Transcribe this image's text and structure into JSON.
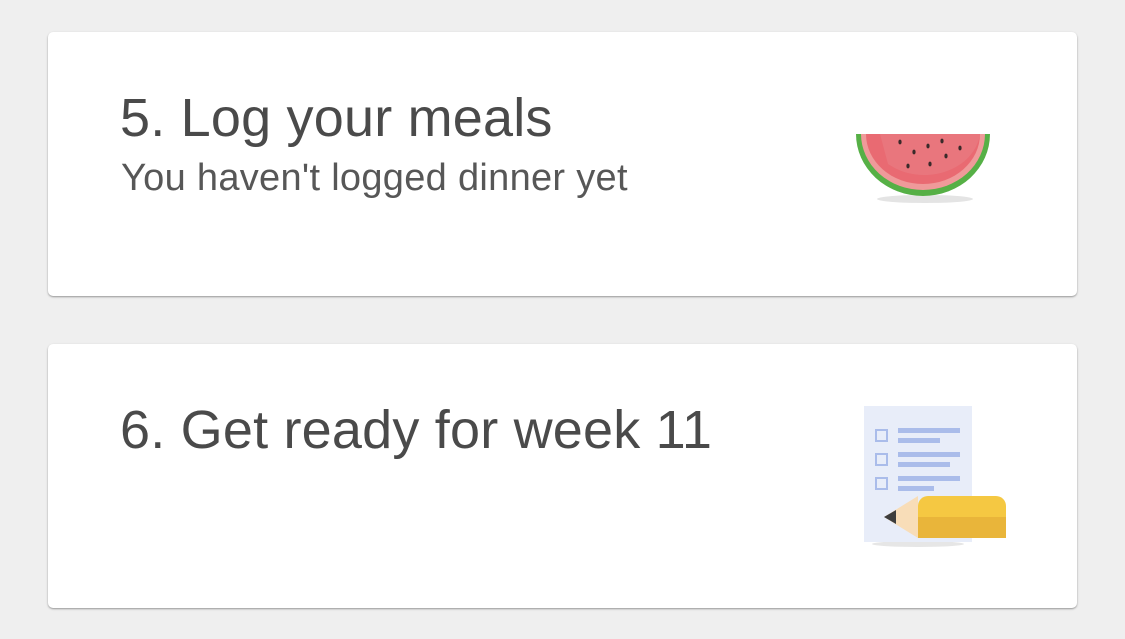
{
  "tasks": [
    {
      "title": "5. Log your meals",
      "subtitle": "You haven't logged dinner yet",
      "icon": "watermelon-icon"
    },
    {
      "title": "6. Get ready for week 11",
      "subtitle": "",
      "icon": "checklist-pencil-icon"
    }
  ],
  "colors": {
    "background": "#efefef",
    "card": "#ffffff",
    "text": "#4a4a4a",
    "watermelon_flesh": "#e96a72",
    "watermelon_rind": "#56b046",
    "pencil": "#f5c842",
    "paper": "#e8edf9",
    "line": "#aabcea"
  }
}
